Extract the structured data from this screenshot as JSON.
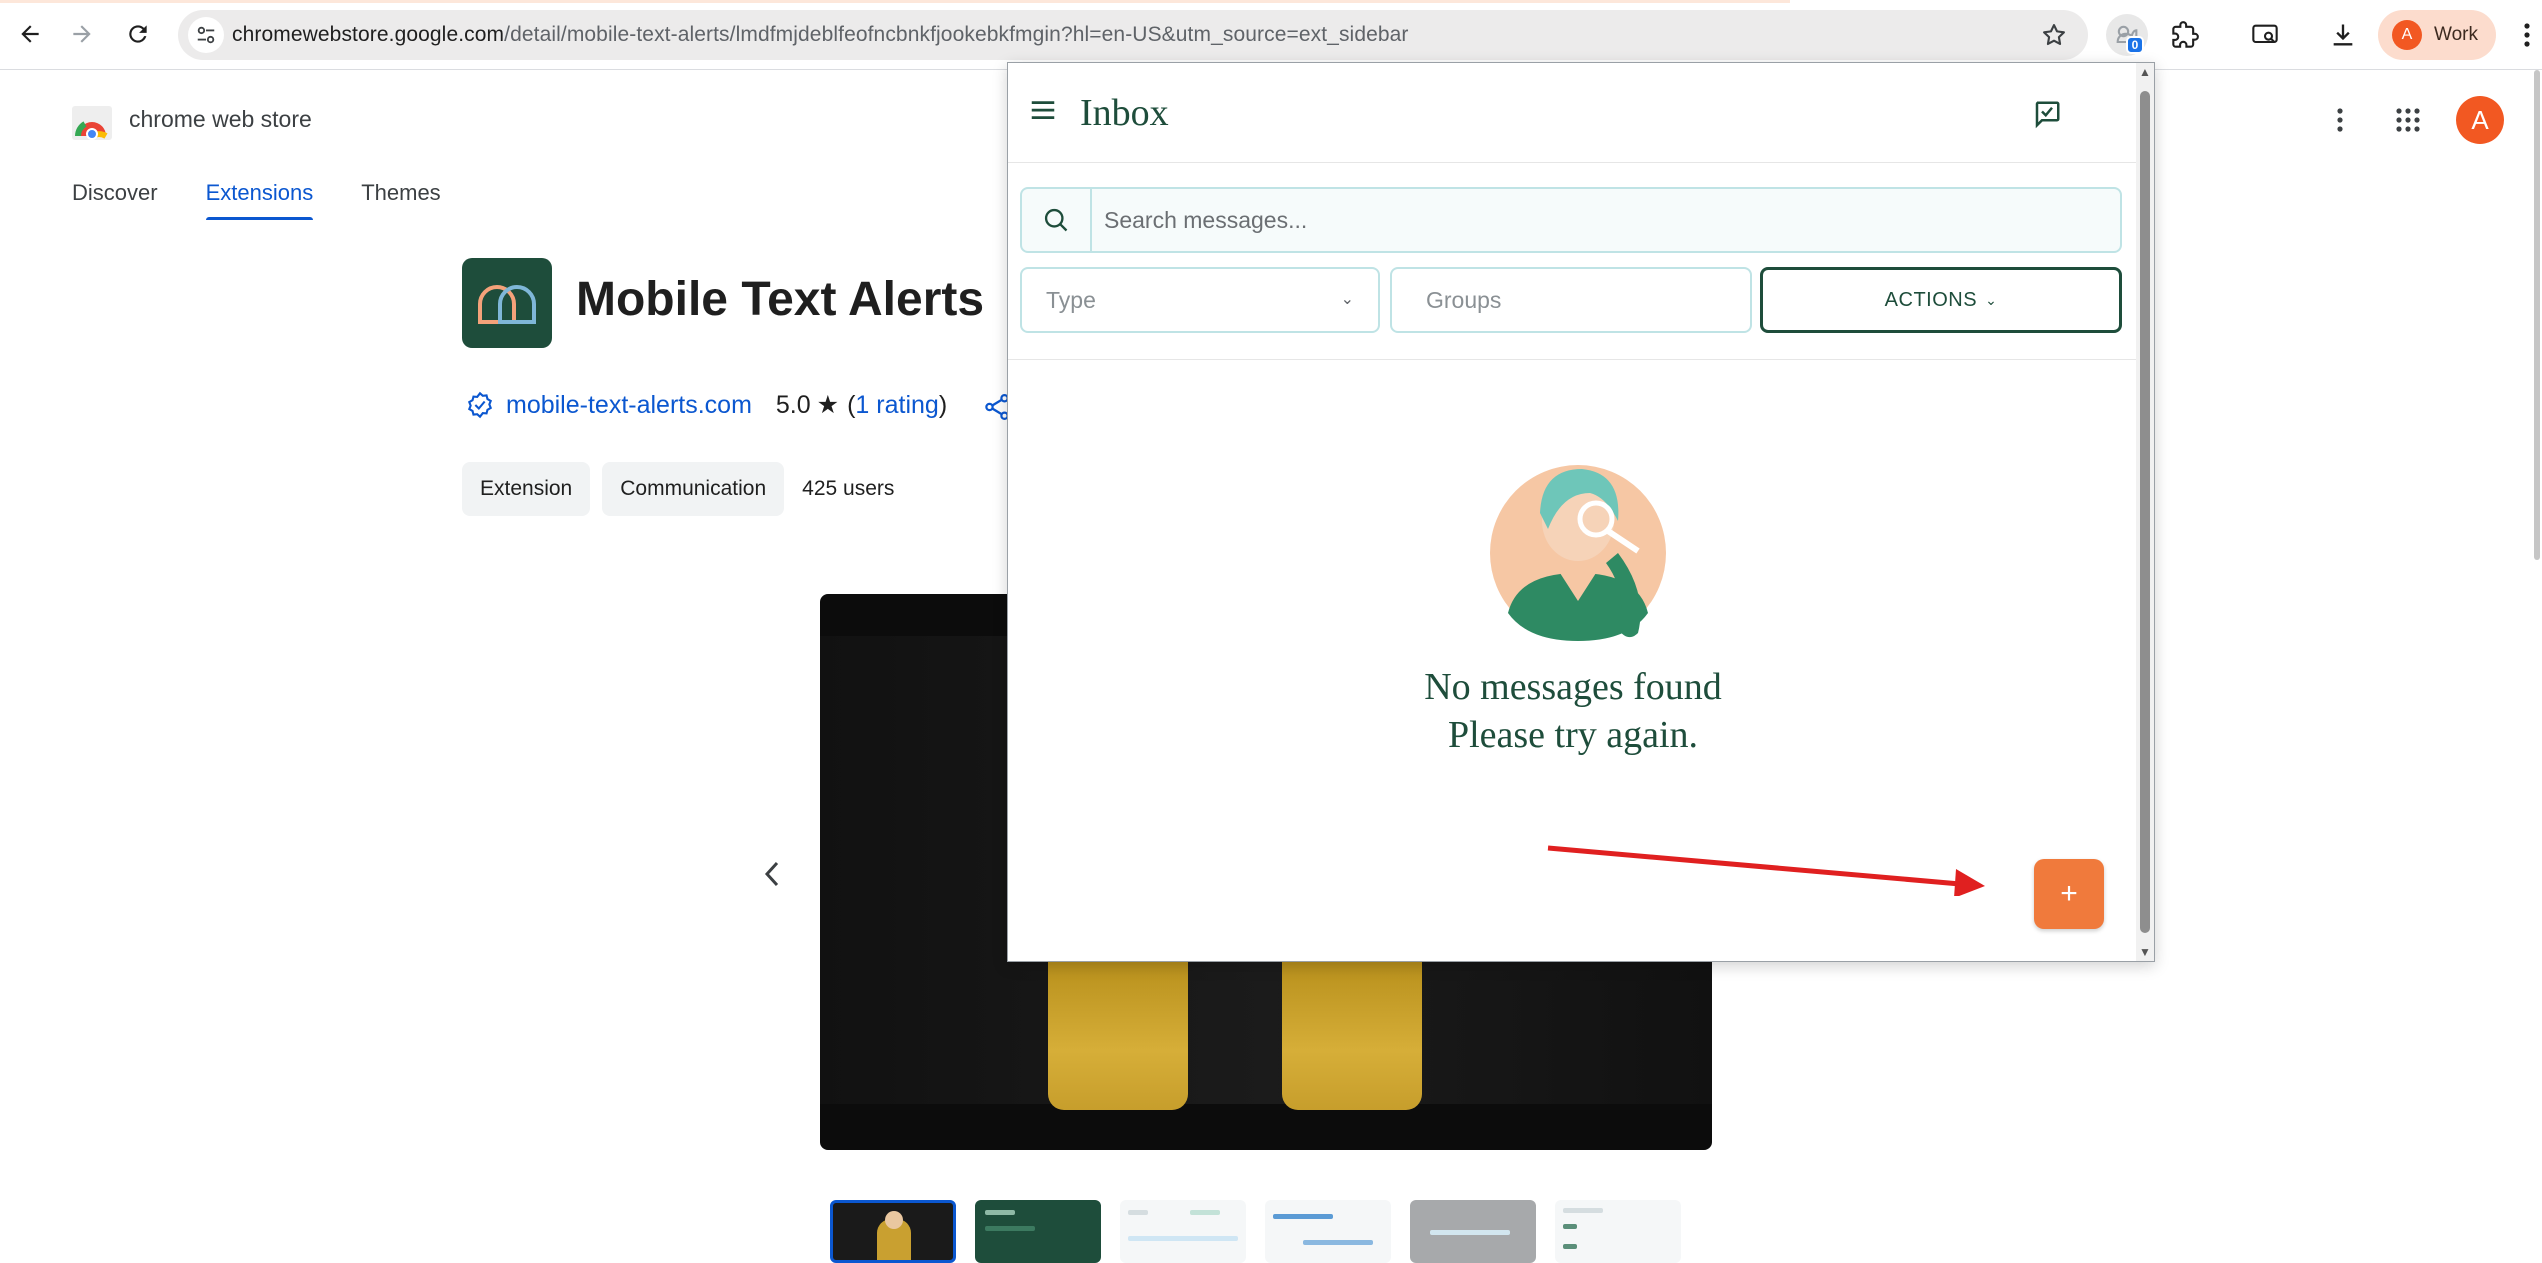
{
  "browser": {
    "url_host": "chromewebstore.google.com",
    "url_path": "/detail/mobile-text-alerts/lmdfmjdeblfeofncbnkfjookebkfmgin?hl=en-US&utm_source=ext_sidebar",
    "extension_badge": "0",
    "profile_initial": "A",
    "profile_label": "Work",
    "icons": [
      "back-icon",
      "forward-icon",
      "reload-icon",
      "site-info-icon",
      "bookmark-star-icon",
      "extension-icon",
      "puzzle-icon",
      "cast-icon",
      "download-icon",
      "menu-icon"
    ]
  },
  "store": {
    "name": "chrome web store",
    "tabs": [
      {
        "label": "Discover"
      },
      {
        "label": "Extensions",
        "active": true
      },
      {
        "label": "Themes"
      }
    ],
    "account_initial": "A"
  },
  "extension": {
    "title": "Mobile Text Alerts",
    "publisher": "mobile-text-alerts.com",
    "rating": "5.0",
    "rating_count_open": "(",
    "rating_count_link": "1 rating",
    "rating_count_close": ")",
    "chips": [
      "Extension",
      "Communication"
    ],
    "users": "425 users"
  },
  "popup": {
    "title": "Inbox",
    "search_placeholder": "Search messages...",
    "type_placeholder": "Type",
    "groups_placeholder": "Groups",
    "actions_label": "ACTIONS",
    "empty_line1": "No messages found",
    "empty_line2": "Please try again.",
    "fab_label": "+"
  },
  "colors": {
    "brand_green": "#1e4d3b",
    "accent_orange": "#f07a3c",
    "link_blue": "#0b57d0",
    "annotation_red": "#e02020"
  }
}
